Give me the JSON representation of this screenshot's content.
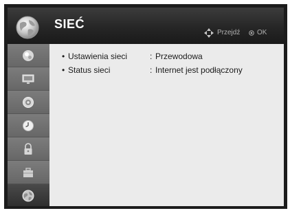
{
  "header": {
    "title": "SIEĆ",
    "icon": "globe-icon",
    "hints": {
      "nav_label": "Przejdź",
      "nav_icon": "navigation-arrows-icon",
      "ok_label": "OK",
      "ok_icon": "ok-button-icon"
    }
  },
  "sidebar": {
    "items": [
      {
        "name": "picture-icon"
      },
      {
        "name": "screen-icon"
      },
      {
        "name": "audio-icon"
      },
      {
        "name": "time-icon"
      },
      {
        "name": "lock-icon"
      },
      {
        "name": "option-icon"
      },
      {
        "name": "network-icon",
        "active": true
      }
    ]
  },
  "settings": [
    {
      "bullet": "•",
      "label": "Ustawienia sieci",
      "separator": ":",
      "value": "Przewodowa"
    },
    {
      "bullet": "•",
      "label": "Status sieci",
      "separator": ":",
      "value": "Internet jest podłączony"
    }
  ],
  "colors": {
    "header": "#262626",
    "sidebar": "#6e6e6e",
    "sidebar_active": "#3a3a3a",
    "content": "#ebebeb",
    "text": "#1a1a1a",
    "hint": "#b0b0b0"
  }
}
